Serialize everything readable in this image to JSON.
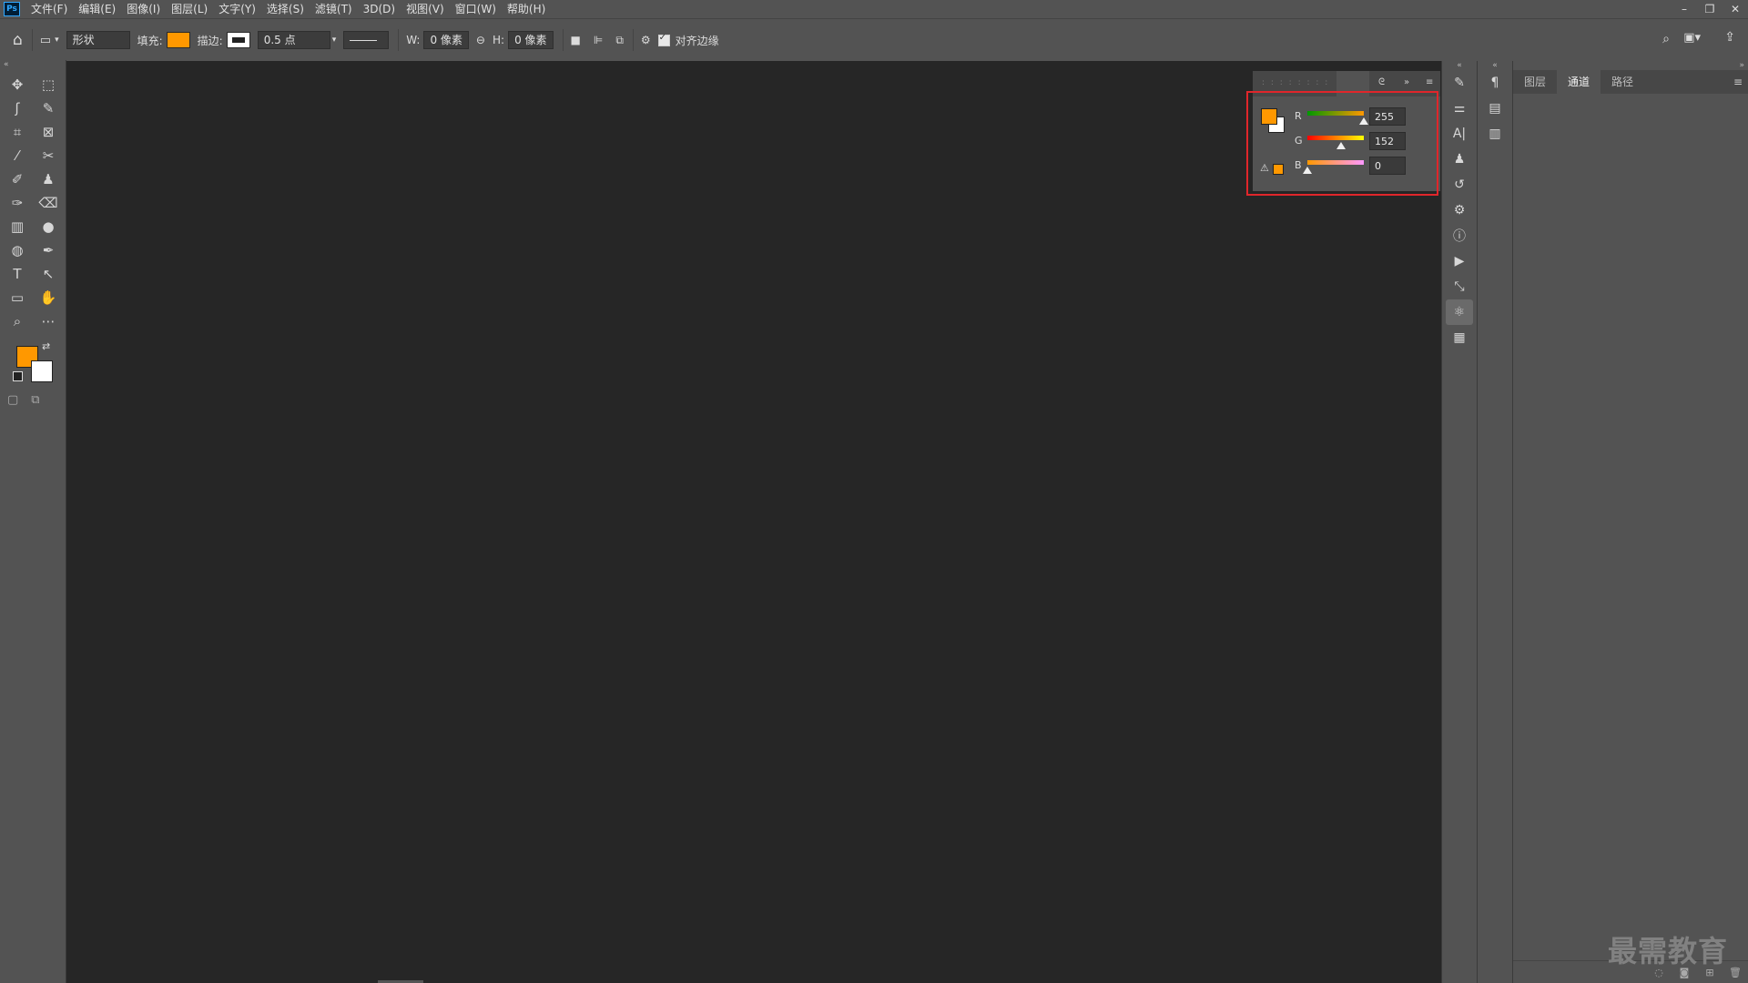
{
  "menubar": {
    "logo": "Ps",
    "items": [
      "文件(F)",
      "编辑(E)",
      "图像(I)",
      "图层(L)",
      "文字(Y)",
      "选择(S)",
      "滤镜(T)",
      "3D(D)",
      "视图(V)",
      "窗口(W)",
      "帮助(H)"
    ],
    "window_controls": [
      "–",
      "❐",
      "✕"
    ]
  },
  "options": {
    "mode_value": "形状",
    "fill_label": "填充:",
    "fill_color": "#ff9800",
    "stroke_label": "描边:",
    "stroke_width": "0.5 点",
    "w_label": "W:",
    "w_value": "0 像素",
    "h_label": "H:",
    "h_value": "0 像素",
    "align_edges_label": "对齐边缘",
    "align_edges_checked": true
  },
  "tools": [
    {
      "icon": "move-icon",
      "glyph": "✥"
    },
    {
      "icon": "marquee-icon",
      "glyph": "⬚"
    },
    {
      "icon": "lasso-icon",
      "glyph": "ʃ"
    },
    {
      "icon": "quick-select-icon",
      "glyph": "✎"
    },
    {
      "icon": "crop-icon",
      "glyph": "⌗"
    },
    {
      "icon": "frame-icon",
      "glyph": "⊠"
    },
    {
      "icon": "eyedropper-icon",
      "glyph": "⁄"
    },
    {
      "icon": "healing-icon",
      "glyph": "✂"
    },
    {
      "icon": "brush-icon",
      "glyph": "✐"
    },
    {
      "icon": "stamp-icon",
      "glyph": "♟"
    },
    {
      "icon": "history-brush-icon",
      "glyph": "✑"
    },
    {
      "icon": "eraser-icon",
      "glyph": "⌫"
    },
    {
      "icon": "gradient-icon",
      "glyph": "▥"
    },
    {
      "icon": "blur-icon",
      "glyph": "●"
    },
    {
      "icon": "dodge-icon",
      "glyph": "◍"
    },
    {
      "icon": "pen-icon",
      "glyph": "✒"
    },
    {
      "icon": "type-icon",
      "glyph": "T"
    },
    {
      "icon": "path-select-icon",
      "glyph": "↖"
    },
    {
      "icon": "rectangle-icon",
      "glyph": "▭"
    },
    {
      "icon": "hand-icon",
      "glyph": "✋"
    },
    {
      "icon": "zoom-icon",
      "glyph": "⌕"
    },
    {
      "icon": "more-tools-icon",
      "glyph": "⋯"
    }
  ],
  "colors": {
    "foreground": "#ff9800",
    "background": "#ffffff",
    "accent_highlight": "#e0262b"
  },
  "color_panel": {
    "channels": [
      {
        "label": "R",
        "value": "255",
        "fraction": 1.0
      },
      {
        "label": "G",
        "value": "152",
        "fraction": 0.596
      },
      {
        "label": "B",
        "value": "0",
        "fraction": 0.0
      }
    ]
  },
  "side_icons_col1": [
    "brush-settings-icon",
    "adjustments-icon",
    "character-icon",
    "clone-source-icon",
    "history-icon",
    "properties-icon",
    "info-icon",
    "actions-icon",
    "paths-icon",
    "3d-icon",
    "table-icon"
  ],
  "side_icons_col2": [
    "paragraph-icon",
    "library-icon",
    "notes-icon"
  ],
  "right_panel": {
    "tabs": [
      "图层",
      "通道",
      "路径"
    ],
    "active_tab": "通道"
  },
  "watermark": "最需教育"
}
